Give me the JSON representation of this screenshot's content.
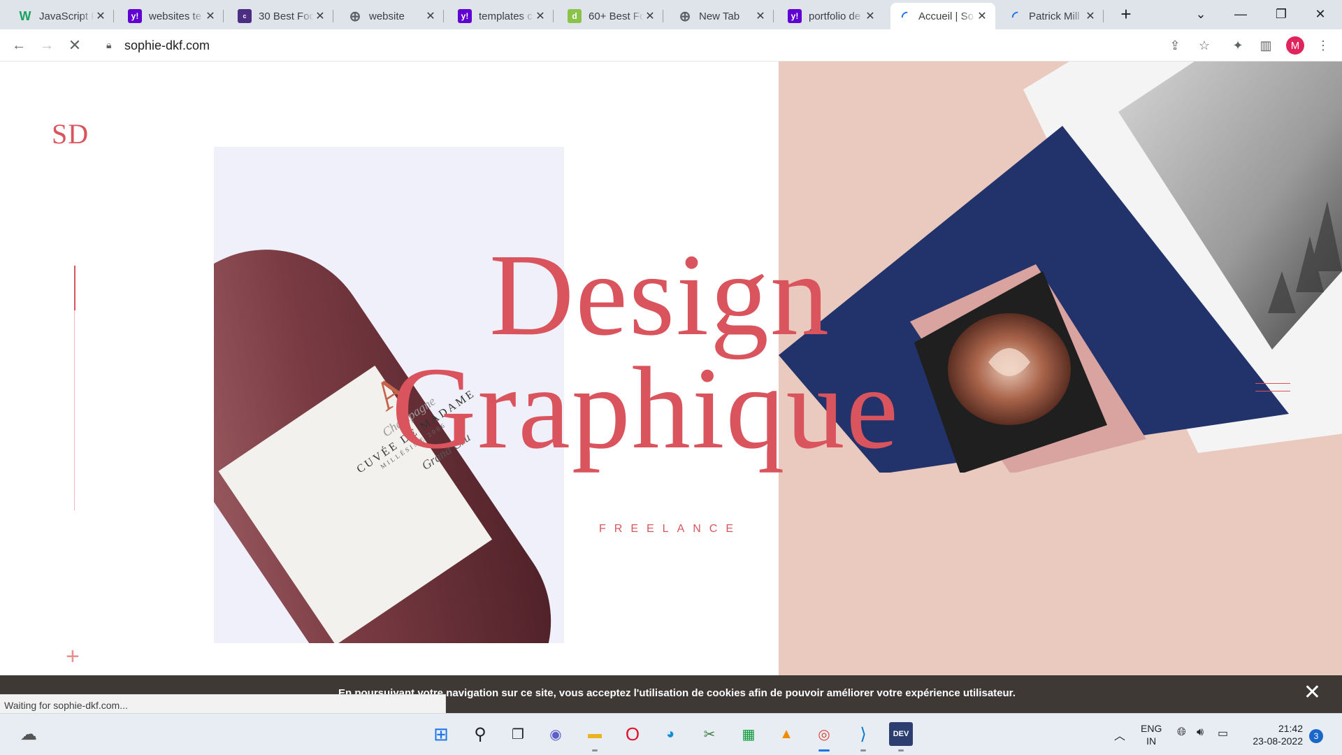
{
  "browser": {
    "tabs": [
      {
        "title": "JavaScript F",
        "favicon": "w-icon",
        "fav_color": "#1aa260",
        "fav_text": "W"
      },
      {
        "title": "websites te",
        "favicon": "yahoo-icon",
        "fav_color": "#6001d2",
        "fav_text": "y!"
      },
      {
        "title": "30 Best Foo",
        "favicon": "colorlib-icon",
        "fav_color": "#4b2e83",
        "fav_text": "c"
      },
      {
        "title": "website",
        "favicon": "globe-icon",
        "fav_color": "#5f6368",
        "fav_text": "⊕"
      },
      {
        "title": "templates c",
        "favicon": "yahoo-icon",
        "fav_color": "#6001d2",
        "fav_text": "y!"
      },
      {
        "title": "60+ Best Fo",
        "favicon": "d-icon",
        "fav_color": "#8bc34a",
        "fav_text": "d"
      },
      {
        "title": "New Tab",
        "favicon": "globe-icon",
        "fav_color": "#5f6368",
        "fav_text": "⊕"
      },
      {
        "title": "portfolio de",
        "favicon": "yahoo-icon",
        "fav_color": "#6001d2",
        "fav_text": "y!"
      },
      {
        "title": "Accueil | So",
        "favicon": "loading-icon",
        "fav_color": "#1a73e8",
        "fav_text": "◜",
        "active": true
      },
      {
        "title": "Patrick Mill",
        "favicon": "loading-icon",
        "fav_color": "#1a73e8",
        "fav_text": "◜"
      }
    ],
    "tab_close_glyph": "✕",
    "new_tab_glyph": "+",
    "url": "sophie-dkf.com",
    "profile_initial": "M",
    "status_text": "Waiting for sophie-dkf.com..."
  },
  "site": {
    "logo": "SD",
    "hero_line1": "Design",
    "hero_line2": "Graphique",
    "tagline": "FREELANCE",
    "label_brand": "Champagne",
    "label_name": "CUVÉE DE MADAME",
    "label_sub": "MILLÉSIME 2006",
    "label_cru": "Grand Cru",
    "label_letter": "A",
    "cookie_text": "En poursuivant votre navigation sur ce site, vous acceptez l'utilisation de cookies afin de pouvoir améliorer votre expérience utilisateur.",
    "cookie_close": "✕"
  },
  "taskbar": {
    "lang_top": "ENG",
    "lang_bottom": "IN",
    "time": "21:42",
    "date": "23-08-2022",
    "notifications": "3"
  },
  "colors": {
    "accent": "#d9545c",
    "pink_panel": "#eac9be",
    "navy": "#22336b"
  }
}
